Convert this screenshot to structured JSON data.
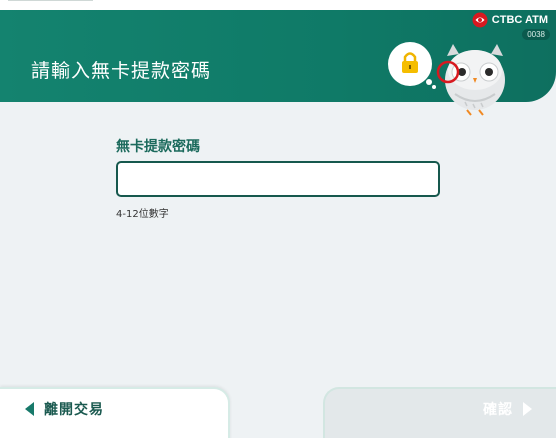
{
  "header": {
    "title": "請輸入無卡提款密碼",
    "brand": "CTBC ATM",
    "terminal_id": "0038"
  },
  "form": {
    "label": "無卡提款密碼",
    "value": "",
    "hint": "4-12位數字"
  },
  "footer": {
    "cancel_label": "離開交易",
    "confirm_label": "確認"
  },
  "icons": {
    "brand": "ctbc-logo-icon",
    "mascot": "owl-mascot-icon",
    "lock": "lock-icon",
    "cancel": "arrow-left-icon",
    "confirm": "arrow-right-icon"
  },
  "colors": {
    "header": "#14836f",
    "accent": "#1b6a5c",
    "background": "#eef2f4",
    "brand_red": "#d71920"
  }
}
